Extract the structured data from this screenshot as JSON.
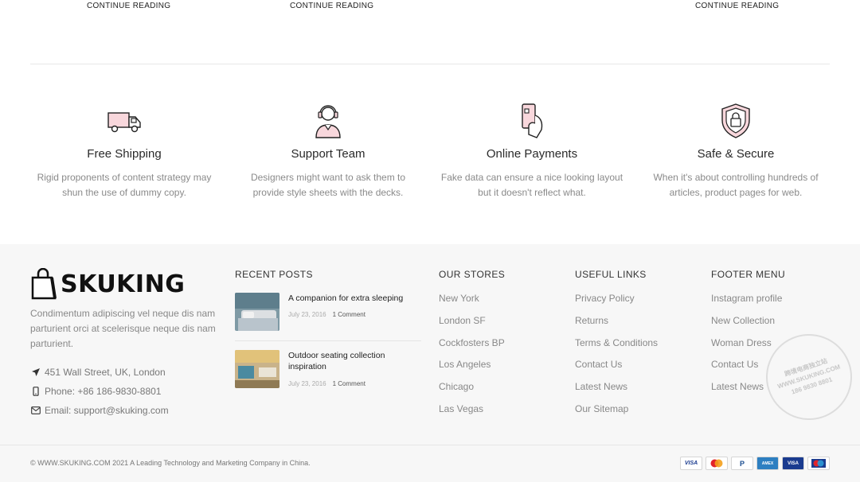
{
  "top_links": [
    "CONTINUE READING",
    "CONTINUE READING",
    "CONTINUE READING"
  ],
  "features": [
    {
      "icon": "truck-icon",
      "title": "Free Shipping",
      "desc": "Rigid proponents of content strategy may shun the use of dummy copy."
    },
    {
      "icon": "support-agent-icon",
      "title": "Support Team",
      "desc": "Designers might want to ask them to provide style sheets with the decks."
    },
    {
      "icon": "card-payment-icon",
      "title": "Online Payments",
      "desc": "Fake data can ensure a nice looking layout but it doesn't reflect what."
    },
    {
      "icon": "shield-lock-icon",
      "title": "Safe & Secure",
      "desc": "When it's about controlling hundreds of articles, product pages for web."
    }
  ],
  "footer": {
    "logo_text": "SKUKING",
    "about": "Condimentum adipiscing vel neque dis nam parturient orci at scelerisque neque dis nam parturient.",
    "address": "451 Wall Street, UK, London",
    "phone": "Phone: +86 186-9830-8801",
    "email": "Email: support@skuking.com",
    "recent_posts": {
      "title": "RECENT POSTS",
      "posts": [
        {
          "title": "A companion for extra sleeping",
          "date": "July 23, 2016",
          "comments": "1 Comment"
        },
        {
          "title": "Outdoor seating collection inspiration",
          "date": "July 23, 2016",
          "comments": "1 Comment"
        }
      ]
    },
    "stores": {
      "title": "OUR STORES",
      "items": [
        "New York",
        "London SF",
        "Cockfosters BP",
        "Los Angeles",
        "Chicago",
        "Las Vegas"
      ]
    },
    "useful_links": {
      "title": "USEFUL LINKS",
      "items": [
        "Privacy Policy",
        "Returns",
        "Terms & Conditions",
        "Contact Us",
        "Latest News",
        "Our Sitemap"
      ]
    },
    "footer_menu": {
      "title": "FOOTER MENU",
      "items": [
        "Instagram profile",
        "New Collection",
        "Woman Dress",
        "Contact Us",
        "Latest News"
      ]
    },
    "watermark": {
      "line1": "跨境电商独立站",
      "line2": "WWW.SKUKING.COM",
      "line3": "186 9830 8801"
    },
    "copyright": "© WWW.SKUKING.COM 2021 A Leading Technology and Marketing Company in China.",
    "payments": [
      "VISA",
      "Mastercard",
      "PayPal",
      "American Express",
      "VISA Electron",
      "Maestro"
    ]
  },
  "colors": {
    "footer_bg": "#f7f7f7",
    "accent": "#111111",
    "muted": "#888888",
    "icon_pink": "#f8d7dc"
  }
}
